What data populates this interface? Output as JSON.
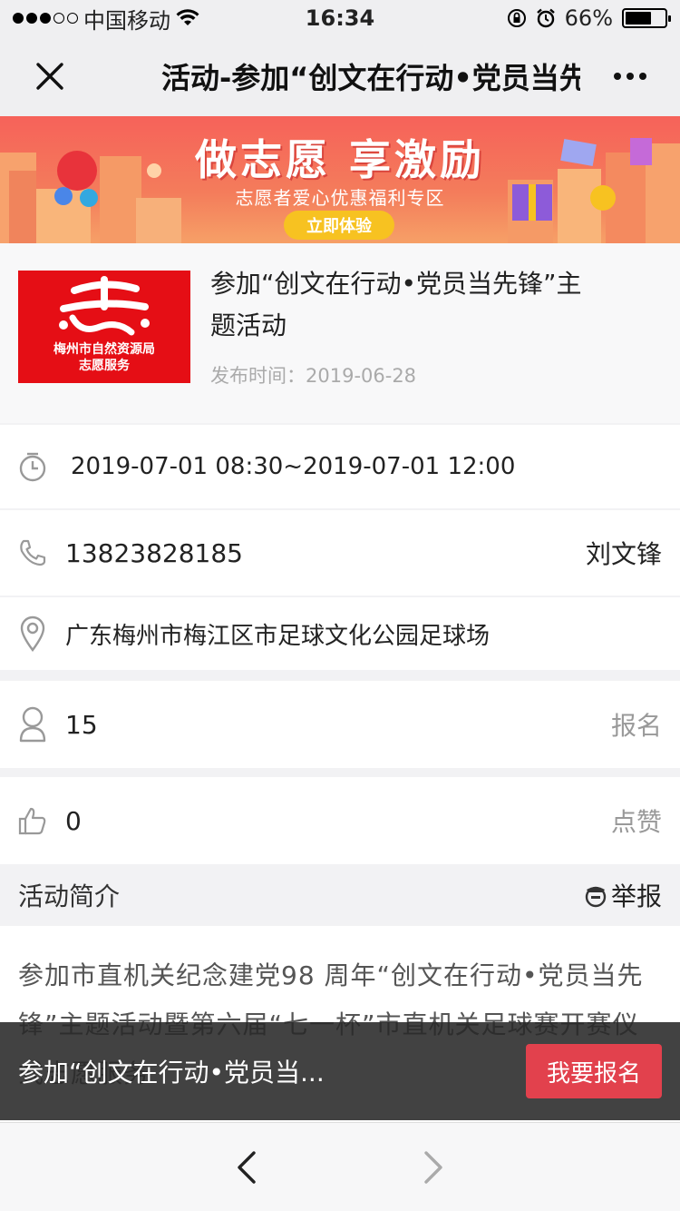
{
  "status_bar": {
    "carrier": "中国移动",
    "time": "16:34",
    "battery_text": "66%",
    "battery_level": 0.66,
    "signal_strength": 3
  },
  "nav": {
    "title": "活动-参加“创文在行动•党员当先锋”主题活动"
  },
  "banner": {
    "title": "做志愿 享激励",
    "subtitle": "志愿者爱心优惠福利专区",
    "button": "立即体验"
  },
  "event": {
    "logo_glyph": "志",
    "logo_caption_line1": "梅州市自然资源局",
    "logo_caption_line2": "志愿服务",
    "title": "参加“创文在行动•党员当先锋”主题活动",
    "publish_label": "发布时间：",
    "publish_date": "2019-06-28"
  },
  "details": {
    "time_range": "2019-07-01 08:30~2019-07-01 12:00",
    "phone": "13823828185",
    "contact_name": "刘文锋",
    "address": "广东梅州市梅江区市足球文化公园足球场",
    "participants": "15",
    "signup_label": "报名",
    "likes": "0",
    "like_label": "点赞"
  },
  "intro": {
    "header": "活动简介",
    "report_label": "举报",
    "text": "参加市直机关纪念建党98 周年“创文在行动•党员当先锋”主题活动暨第六届“七一杯”市直机关足球赛开赛仪式志愿服务"
  },
  "signup_bar": {
    "title": "参加“创文在行动•党员当...",
    "button": "我要报名"
  },
  "colors": {
    "accent_red": "#e2414d",
    "logo_red": "#e50e15",
    "banner_button": "#f7c221"
  }
}
